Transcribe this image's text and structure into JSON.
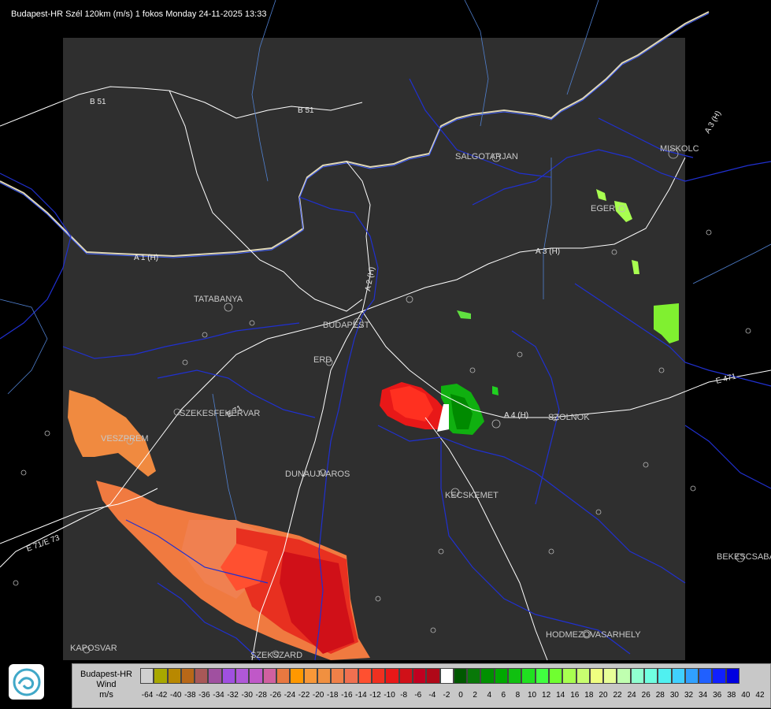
{
  "title": "Budapest-HR Szél 120km (m/s) 1 fokos Monday 24-11-2025 13:33",
  "cities": [
    {
      "name": "SALGOTARJAN"
    },
    {
      "name": "MISKOLC"
    },
    {
      "name": "EGER"
    },
    {
      "name": "TATABANYA"
    },
    {
      "name": "BUDAPEST"
    },
    {
      "name": "ERD"
    },
    {
      "name": "SZEKESFEHERVAR"
    },
    {
      "name": "SZOLNOK"
    },
    {
      "name": "VESZPREM"
    },
    {
      "name": "DUNAUJVAROS"
    },
    {
      "name": "KECSKEMET"
    },
    {
      "name": "BEKESCSABA"
    },
    {
      "name": "HODMEZOVASARHELY"
    },
    {
      "name": "KAPOSVAR"
    },
    {
      "name": "SZEKSZARD"
    }
  ],
  "roads": [
    "B 51",
    "B 51",
    "A 3 (H)",
    "A 1 (H)",
    "A 2 (H)",
    "A 3 (H)",
    "A 4 (H)",
    "E 471",
    "E 71",
    "E 71/E 73"
  ],
  "legend": {
    "title_line1": "Budapest-HR",
    "title_line2": "Wind",
    "unit": "m/s",
    "colors": [
      "#d0d0d0",
      "#a8a800",
      "#b88800",
      "#b86818",
      "#a85858",
      "#a050a0",
      "#a050e0",
      "#b058d8",
      "#c058c8",
      "#d060a0",
      "#e87840",
      "#ff9800",
      "#f89838",
      "#f09040",
      "#f08048",
      "#f07050",
      "#ff5030",
      "#f03020",
      "#e81818",
      "#d01018",
      "#c00020",
      "#b00818",
      "#ffffff",
      "#005800",
      "#087808",
      "#009000",
      "#00a800",
      "#10c010",
      "#20e020",
      "#40ff40",
      "#70ff30",
      "#a8ff50",
      "#c8ff70",
      "#f0ff80",
      "#e8ff98",
      "#c0ffb0",
      "#90ffd0",
      "#70ffe0",
      "#50f0f0",
      "#40d0ff",
      "#30a0ff",
      "#2060ff",
      "#1020ff",
      "#0000e0"
    ],
    "ticks": [
      "-64",
      "-42",
      "-40",
      "-38",
      "-36",
      "-34",
      "-32",
      "-30",
      "-28",
      "-26",
      "-24",
      "-22",
      "-20",
      "-18",
      "-16",
      "-14",
      "-12",
      "-10",
      "-8",
      "-6",
      "-4",
      "-2",
      "0",
      "2",
      "4",
      "6",
      "8",
      "10",
      "12",
      "14",
      "16",
      "18",
      "20",
      "22",
      "24",
      "26",
      "28",
      "30",
      "32",
      "34",
      "36",
      "38",
      "40",
      "42"
    ]
  },
  "logo_icon": "wave-logo-icon"
}
